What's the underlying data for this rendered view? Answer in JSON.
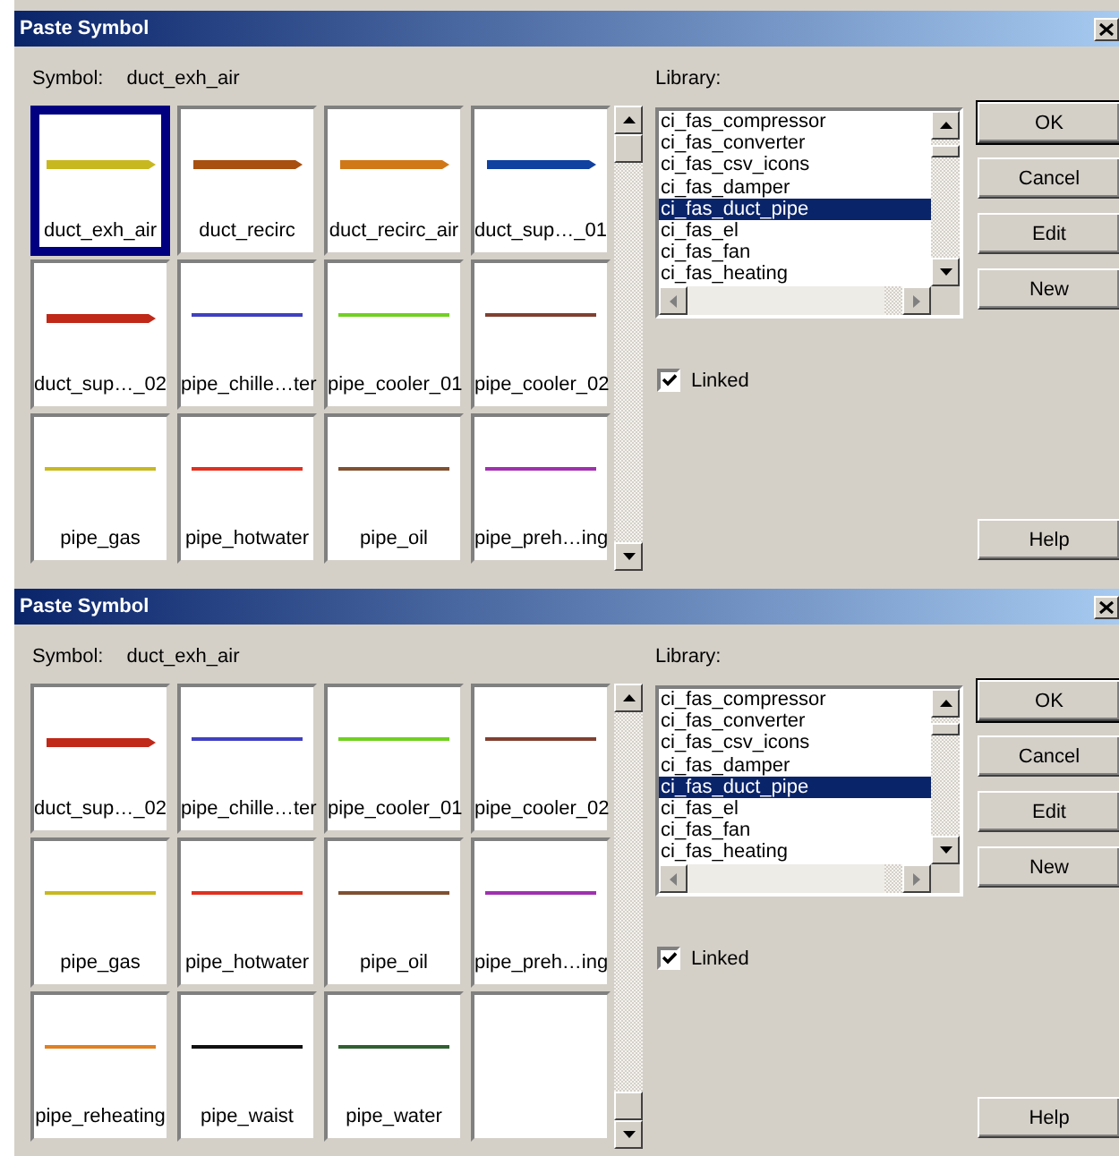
{
  "dialogs": [
    {
      "title": "Paste Symbol",
      "symbol_label": "Symbol:",
      "symbol_value": "duct_exh_air",
      "scrolled_to_end": false,
      "tiles": [
        {
          "label": "duct_exh_air",
          "kind": "duct",
          "color": "#c8b820",
          "selected": true
        },
        {
          "label": "duct_recirc",
          "kind": "duct",
          "color": "#a85010",
          "selected": false
        },
        {
          "label": "duct_recirc_air",
          "kind": "duct",
          "color": "#d07818",
          "selected": false
        },
        {
          "label": "duct_sup…_01",
          "kind": "duct",
          "color": "#1040a0",
          "selected": false
        },
        {
          "label": "duct_sup…_02",
          "kind": "duct",
          "color": "#c02818",
          "selected": false
        },
        {
          "label": "pipe_chille…ter",
          "kind": "pipe",
          "color": "#4040c0",
          "selected": false
        },
        {
          "label": "pipe_cooler_01",
          "kind": "pipe",
          "color": "#70d020",
          "selected": false
        },
        {
          "label": "pipe_cooler_02",
          "kind": "pipe",
          "color": "#804030",
          "selected": false
        },
        {
          "label": "pipe_gas",
          "kind": "pipe",
          "color": "#c8b820",
          "selected": false
        },
        {
          "label": "pipe_hotwater",
          "kind": "pipe",
          "color": "#e03020",
          "selected": false
        },
        {
          "label": "pipe_oil",
          "kind": "pipe",
          "color": "#805030",
          "selected": false
        },
        {
          "label": "pipe_preh…ing",
          "kind": "pipe",
          "color": "#a030b0",
          "selected": false
        }
      ],
      "library_label": "Library:",
      "library": [
        {
          "label": "ci_fas_compressor",
          "selected": false
        },
        {
          "label": "ci_fas_converter",
          "selected": false
        },
        {
          "label": "ci_fas_csv_icons",
          "selected": false
        },
        {
          "label": "ci_fas_damper",
          "selected": false
        },
        {
          "label": "ci_fas_duct_pipe",
          "selected": true
        },
        {
          "label": "ci_fas_el",
          "selected": false
        },
        {
          "label": "ci_fas_fan",
          "selected": false
        },
        {
          "label": "ci_fas_heating",
          "selected": false
        }
      ],
      "linked": {
        "label": "Linked",
        "checked": true
      },
      "buttons": [
        "OK",
        "Cancel",
        "Edit",
        "New"
      ],
      "help_button": "Help"
    },
    {
      "title": "Paste Symbol",
      "symbol_label": "Symbol:",
      "symbol_value": "duct_exh_air",
      "scrolled_to_end": true,
      "tiles": [
        {
          "label": "duct_sup…_02",
          "kind": "duct",
          "color": "#c02818",
          "selected": false
        },
        {
          "label": "pipe_chille…ter",
          "kind": "pipe",
          "color": "#4040c0",
          "selected": false
        },
        {
          "label": "pipe_cooler_01",
          "kind": "pipe",
          "color": "#70d020",
          "selected": false
        },
        {
          "label": "pipe_cooler_02",
          "kind": "pipe",
          "color": "#804030",
          "selected": false
        },
        {
          "label": "pipe_gas",
          "kind": "pipe",
          "color": "#c8b820",
          "selected": false
        },
        {
          "label": "pipe_hotwater",
          "kind": "pipe",
          "color": "#e03020",
          "selected": false
        },
        {
          "label": "pipe_oil",
          "kind": "pipe",
          "color": "#805030",
          "selected": false
        },
        {
          "label": "pipe_preh…ing",
          "kind": "pipe",
          "color": "#a030b0",
          "selected": false
        },
        {
          "label": "pipe_reheating",
          "kind": "pipe",
          "color": "#e08020",
          "selected": false
        },
        {
          "label": "pipe_waist",
          "kind": "pipe",
          "color": "#101010",
          "selected": false
        },
        {
          "label": "pipe_water",
          "kind": "pipe",
          "color": "#306030",
          "selected": false
        },
        {
          "kind": "empty",
          "selected": false
        }
      ],
      "library_label": "Library:",
      "library": [
        {
          "label": "ci_fas_compressor",
          "selected": false
        },
        {
          "label": "ci_fas_converter",
          "selected": false
        },
        {
          "label": "ci_fas_csv_icons",
          "selected": false
        },
        {
          "label": "ci_fas_damper",
          "selected": false
        },
        {
          "label": "ci_fas_duct_pipe",
          "selected": true
        },
        {
          "label": "ci_fas_el",
          "selected": false
        },
        {
          "label": "ci_fas_fan",
          "selected": false
        },
        {
          "label": "ci_fas_heating",
          "selected": false
        }
      ],
      "linked": {
        "label": "Linked",
        "checked": true
      },
      "buttons": [
        "OK",
        "Cancel",
        "Edit",
        "New"
      ],
      "help_button": "Help"
    }
  ]
}
